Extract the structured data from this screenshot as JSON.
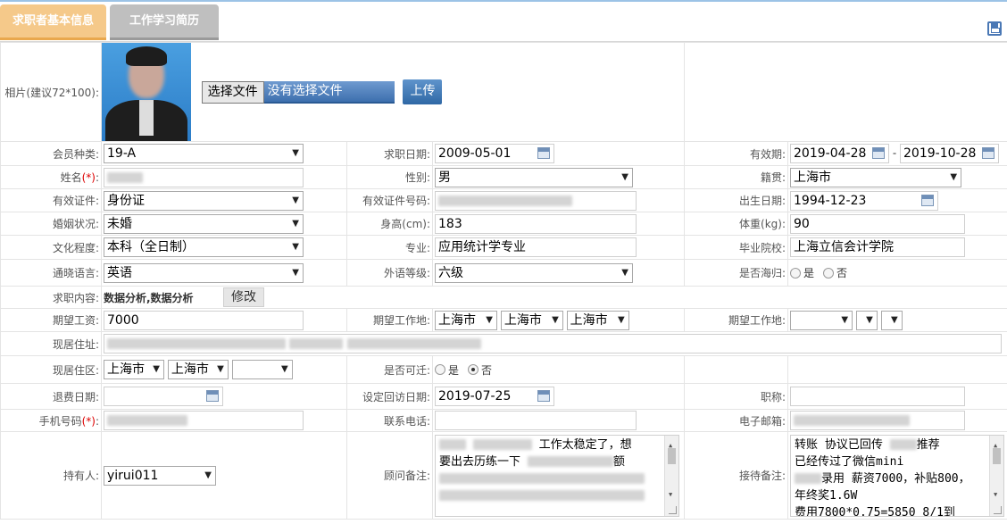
{
  "tabs": {
    "basic": "求职者基本信息",
    "history": "工作学习简历"
  },
  "photo": {
    "label": "相片(建议72*100):",
    "choose_file": "选择文件",
    "no_file": "没有选择文件",
    "upload": "上传"
  },
  "row1": {
    "member_type_label": "会员种类:",
    "member_type_value": "19-A",
    "apply_date_label": "求职日期:",
    "apply_date_value": "2009-05-01",
    "valid_label": "有效期:",
    "valid_from": "2019-04-28",
    "valid_sep": "-",
    "valid_to": "2019-10-28"
  },
  "row2": {
    "name_label": "姓名",
    "req_mark": "(*)",
    "name_colon": ":",
    "gender_label": "性别:",
    "gender_value": "男",
    "native_label": "籍贯:",
    "native_value": "上海市"
  },
  "row3": {
    "idtype_label": "有效证件:",
    "idtype_value": "身份证",
    "idno_label": "有效证件号码:",
    "birth_label": "出生日期:",
    "birth_value": "1994-12-23"
  },
  "row4": {
    "marital_label": "婚姻状况:",
    "marital_value": "未婚",
    "height_label": "身高(cm):",
    "height_value": "183",
    "weight_label": "体重(kg):",
    "weight_value": "90"
  },
  "row5": {
    "edu_label": "文化程度:",
    "edu_value": "本科（全日制）",
    "major_label": "专业:",
    "major_value": "应用统计学专业",
    "school_label": "毕业院校:",
    "school_value": "上海立信会计学院"
  },
  "row6": {
    "lang_label": "通晓语言:",
    "lang_value": "英语",
    "level_label": "外语等级:",
    "level_value": "六级",
    "overseas_label": "是否海归:",
    "yes": "是",
    "no": "否"
  },
  "row7": {
    "content_label": "求职内容:",
    "content_value": "数据分析,数据分析",
    "modify": "修改"
  },
  "row8": {
    "salary_label": "期望工资:",
    "salary_value": "7000",
    "place_label": "期望工作地:",
    "place1": "上海市",
    "place2": "上海市",
    "place3": "上海市",
    "place2_label": "期望工作地:"
  },
  "row9": {
    "address_label": "现居住址:"
  },
  "row10": {
    "area_label": "现居住区:",
    "area1": "上海市",
    "area2": "上海市",
    "relocate_label": "是否可迁:",
    "yes": "是",
    "no": "否"
  },
  "row11": {
    "refund_label": "退费日期:",
    "callback_label": "设定回访日期:",
    "callback_value": "2019-07-25",
    "title_label": "职称:"
  },
  "row12": {
    "mobile_label": "手机号码",
    "req_mark": "(*)",
    "mobile_colon": ":",
    "phone_label": "联系电话:",
    "email_label": "电子邮箱:"
  },
  "row13": {
    "holder_label": "持有人:",
    "holder_value": "yirui011",
    "consultant_label": "顾问备注:",
    "consultant_l1": "工作太稳定了，想",
    "consultant_l2": "要出去历练一下",
    "consultant_l2b": "额",
    "reception_label": "接待备注:",
    "reception_l1a": "转账 协议已回传",
    "reception_l1b": "推荐",
    "reception_l2": "已经传过了微信mini",
    "reception_l3": "录用 薪资7000，补贴800，",
    "reception_l4": "年终奖1.6W",
    "reception_l5": "费用7800*0.75=5850  8/1到"
  }
}
